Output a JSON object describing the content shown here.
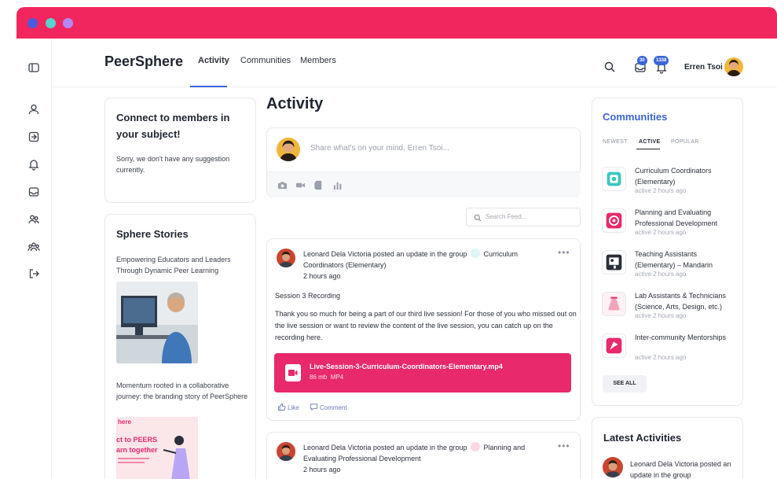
{
  "brand": {
    "name": "PeerSphere",
    "accent": "#f2265e",
    "link_blue": "#3b64d6",
    "attachment_pink": "#e8296b"
  },
  "nav": {
    "tabs": [
      {
        "label": "Activity",
        "active": true
      },
      {
        "label": "Communities"
      },
      {
        "label": "Members"
      }
    ]
  },
  "header": {
    "messages_count": "30",
    "notifications_count": "1338",
    "user_name": "Erren Tsoi"
  },
  "sidebar": {
    "connect": {
      "title": "Connect to members in your subject!",
      "message": "Sorry, we don't have any suggestion currently."
    },
    "stories": {
      "title": "Sphere Stories",
      "items": [
        {
          "title": "Empowering Educators and Leaders Through Dynamic Peer Learning"
        },
        {
          "title": "Momentum rooted in a collaborative journey: the branding story of PeerSphere",
          "image_text_1": "here",
          "image_text_2": "ct to PEERS",
          "image_text_3": "arn together"
        }
      ]
    }
  },
  "main": {
    "title": "Activity",
    "composer": {
      "placeholder": "Share what's on your mind, Erren Tsoi..."
    },
    "search": {
      "placeholder": "Search Feed..."
    },
    "posts": [
      {
        "author": "Leonard Dela Victoria",
        "action": "posted an update in the group",
        "group": "Curriculum Coordinators (Elementary)",
        "group_line1": "Curriculum",
        "group_line2": "Coordinators (Elementary)",
        "time": "2 hours ago",
        "heading": "Session 3 Recording",
        "body": "Thank you so much for being a part of our third live session! For those of you who missed out on the live session or want to review the content of the live session, you can catch up on the recording here.",
        "attachment": {
          "filename": "Live-Session-3-Curriculum-Coordinators-Elementary.mp4",
          "size": "86 mb",
          "type": "MP4"
        },
        "like_label": "Like",
        "comment_label": "Comment"
      },
      {
        "author": "Leonard Dela Victoria",
        "action": "posted an update in the group",
        "group_line1": "Planning and",
        "group_line2": "Evaluating Professional Development",
        "time": "2 hours ago"
      }
    ]
  },
  "communities": {
    "title": "Communities",
    "tabs": [
      {
        "label": "NEWEST"
      },
      {
        "label": "ACTIVE",
        "active": true
      },
      {
        "label": "POPULAR"
      }
    ],
    "items": [
      {
        "name": "Curriculum Coordinators (Elementary)",
        "time": "active 2 hours ago",
        "color": "#3cc6c0"
      },
      {
        "name": "Planning and Evaluating Professional Development",
        "time": "active 2 hours ago",
        "color": "#e8296b"
      },
      {
        "name": "Teaching Assistants (Elementary) – Mandarin",
        "time": "active 2 hours ago",
        "color": "#2b2f3a"
      },
      {
        "name": "Lab Assistants & Technicians (Science, Arts, Design, etc.)",
        "time": "active 2 hours ago",
        "color": "#f3a6b8"
      },
      {
        "name": "Inter-community Mentorships",
        "time": "active 2 hours ago",
        "color": "#e8296b"
      }
    ],
    "see_all": "SEE ALL"
  },
  "latest": {
    "title": "Latest Activities",
    "items": [
      {
        "author": "Leonard Dela Victoria",
        "text": "posted an update in the group"
      }
    ]
  }
}
